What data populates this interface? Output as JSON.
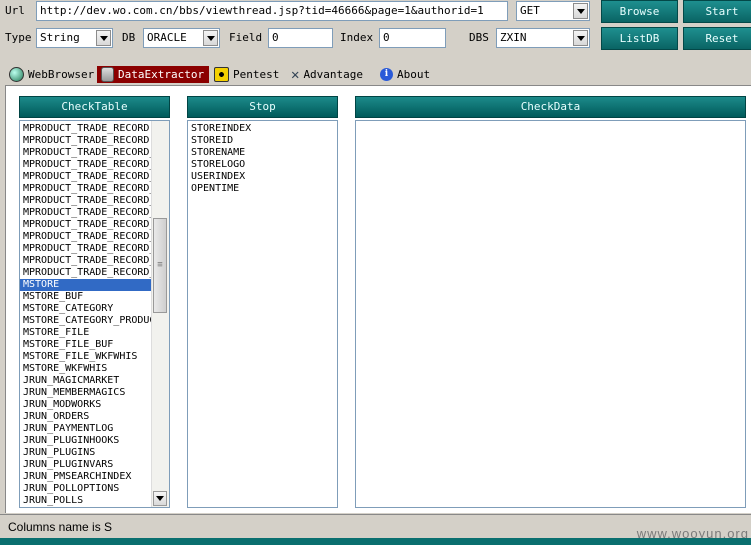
{
  "toolbar": {
    "url_label": "Url",
    "url_value": "http://dev.wo.com.cn/bbs/viewthread.jsp?tid=46666&page=1&authorid=1",
    "method_value": "GET",
    "browse_label": "Browse",
    "start_label": "Start",
    "type_label": "Type",
    "type_value": "String",
    "db_label": "DB",
    "db_value": "ORACLE",
    "field_label": "Field",
    "field_value": "0",
    "index_label": "Index",
    "index_value": "0",
    "dbs_label": "DBS",
    "dbs_value": "ZXIN",
    "listdb_label": "ListDB",
    "reset_label": "Reset"
  },
  "tabs": [
    {
      "label": "WebBrowser",
      "icon": "globe-icon"
    },
    {
      "label": "DataExtractor",
      "icon": "database-icon",
      "active": true
    },
    {
      "label": "Pentest",
      "icon": "radiation-icon"
    },
    {
      "label": "Advantage",
      "icon": "tools-icon"
    },
    {
      "label": "About",
      "icon": "info-icon"
    }
  ],
  "panels": {
    "check_table_header": "CheckTable",
    "stop_header": "Stop",
    "check_data_header": "CheckData"
  },
  "tables": [
    "MPRODUCT_TRADE_RECORD",
    "MPRODUCT_TRADE_RECORD",
    "MPRODUCT_TRADE_RECORD_",
    "MPRODUCT_TRADE_RECORD_",
    "MPRODUCT_TRADE_RECORD_",
    "MPRODUCT_TRADE_RECORD_",
    "MPRODUCT_TRADE_RECORD_",
    "MPRODUCT_TRADE_RECORD_",
    "MPRODUCT_TRADE_RECORD_",
    "MPRODUCT_TRADE_RECORD_",
    "MPRODUCT_TRADE_RECORD_",
    "MPRODUCT_TRADE_RECORD_",
    "MPRODUCT_TRADE_RECORD_",
    "MSTORE",
    "MSTORE_BUF",
    "MSTORE_CATEGORY",
    "MSTORE_CATEGORY_PRODUC",
    "MSTORE_FILE",
    "MSTORE_FILE_BUF",
    "MSTORE_FILE_WKFWHIS",
    "MSTORE_WKFWHIS",
    "JRUN_MAGICMARKET",
    "JRUN_MEMBERMAGICS",
    "JRUN_MODWORKS",
    "JRUN_ORDERS",
    "JRUN_PAYMENTLOG",
    "JRUN_PLUGINHOOKS",
    "JRUN_PLUGINS",
    "JRUN_PLUGINVARS",
    "JRUN_PMSEARCHINDEX",
    "JRUN_POLLOPTIONS",
    "JRUN_POLLS"
  ],
  "selected_table": "MSTORE",
  "columns": [
    "STOREINDEX",
    "STOREID",
    "STORENAME",
    "STORELOGO",
    "USERINDEX",
    "OPENTIME"
  ],
  "status": {
    "text": "Columns name is S",
    "watermark": "www.wooyun.org"
  },
  "colors": {
    "accent": "#0a6f6f",
    "active_tab": "#8b0000",
    "selection": "#316ac5"
  }
}
